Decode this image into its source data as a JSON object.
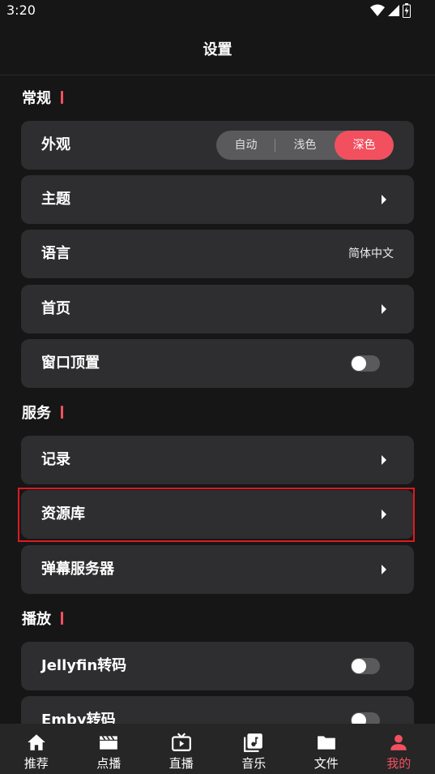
{
  "status_bar": {
    "time": "3:20",
    "icons": [
      "wifi-icon",
      "signal-icon",
      "battery-icon"
    ]
  },
  "header": {
    "title": "设置"
  },
  "sections": {
    "general": {
      "title": "常规"
    },
    "services": {
      "title": "服务"
    },
    "playback": {
      "title": "播放"
    }
  },
  "items": {
    "appearance": {
      "label": "外观",
      "options": [
        "自动",
        "浅色",
        "深色"
      ],
      "selected": "深色"
    },
    "theme": {
      "label": "主题"
    },
    "language": {
      "label": "语言",
      "value": "简体中文"
    },
    "homepage": {
      "label": "首页"
    },
    "pin_window": {
      "label": "窗口顶置",
      "enabled": false
    },
    "history": {
      "label": "记录"
    },
    "library": {
      "label": "资源库"
    },
    "danmaku": {
      "label": "弹幕服务器"
    },
    "jellyfin": {
      "label": "Jellyfin转码",
      "enabled": false
    },
    "emby": {
      "label": "Emby转码",
      "enabled": false
    }
  },
  "bottom_nav": [
    {
      "label": "推荐",
      "icon": "home-icon",
      "active": false
    },
    {
      "label": "点播",
      "icon": "clapperboard-icon",
      "active": false
    },
    {
      "label": "直播",
      "icon": "tv-icon",
      "active": false
    },
    {
      "label": "音乐",
      "icon": "music-icon",
      "active": false
    },
    {
      "label": "文件",
      "icon": "folder-icon",
      "active": false
    },
    {
      "label": "我的",
      "icon": "person-icon",
      "active": true
    }
  ],
  "colors": {
    "accent": "#f2505f",
    "card": "#2e2e30",
    "background": "#161616",
    "highlight": "#e0191f"
  }
}
